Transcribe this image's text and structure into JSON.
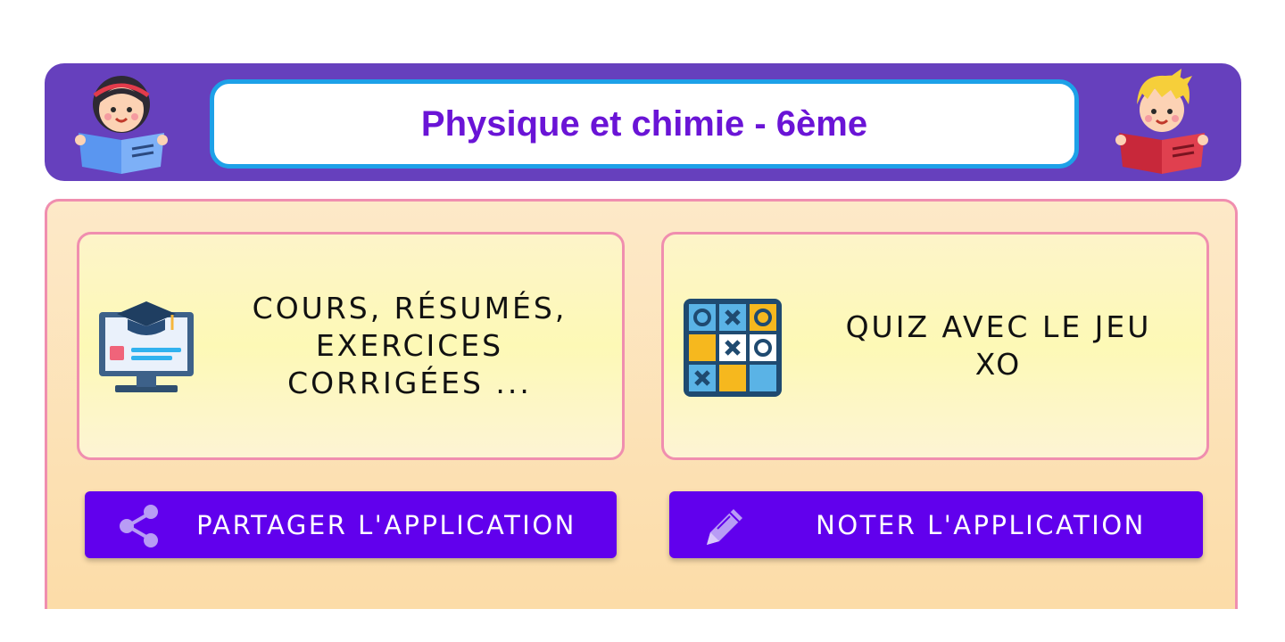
{
  "header": {
    "title": "Physique et chimie - 6ème",
    "left_icon": "girl-reading-icon",
    "right_icon": "boy-reading-icon"
  },
  "cards": {
    "courses": {
      "icon": "graduation-monitor-icon",
      "lines": [
        "COURS, RÉSUMÉS,",
        "EXERCICES",
        "CORRIGÉES ..."
      ]
    },
    "quiz": {
      "icon": "tic-tac-toe-icon",
      "lines": [
        "QUIZ AVEC LE JEU",
        "XO"
      ]
    }
  },
  "buttons": {
    "share": {
      "label": "PARTAGER L'APPLICATION",
      "icon": "share-icon"
    },
    "rate": {
      "label": "NOTER L'APPLICATION",
      "icon": "pencil-icon"
    }
  },
  "colors": {
    "header_bg": "#6640bd",
    "title_border": "#1da1e8",
    "title_text": "#6a14d6",
    "card_border": "#f08eaf",
    "button_bg": "#6100ed"
  }
}
